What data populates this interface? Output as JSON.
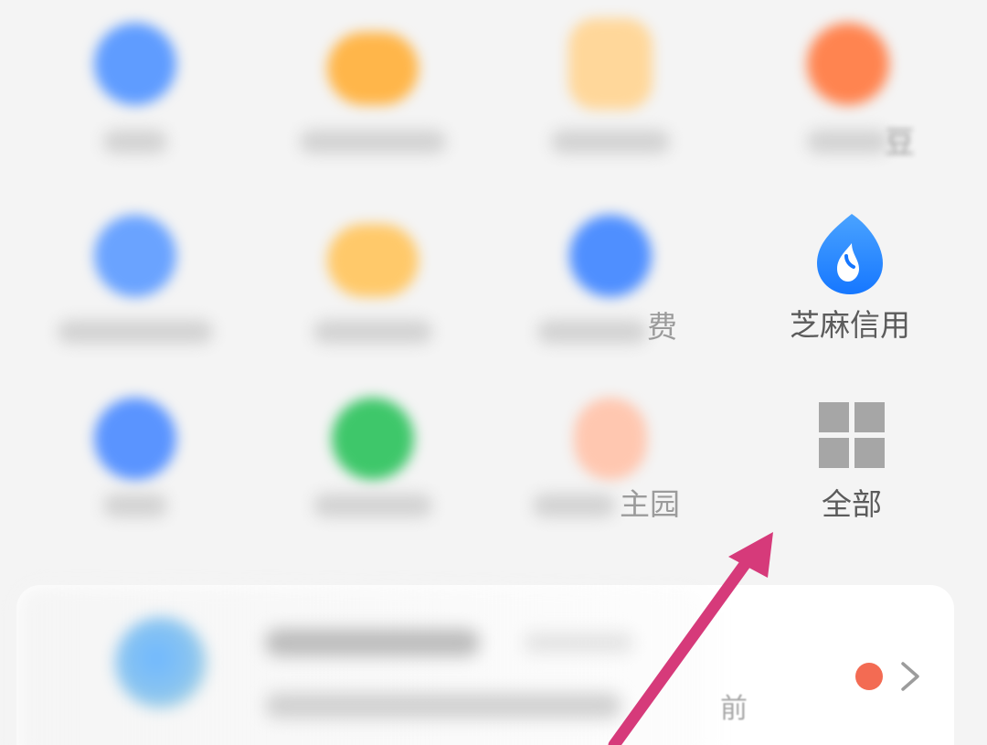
{
  "apps": {
    "zhima": {
      "label": "芝麻信用",
      "icon": "zhima-credit-drop-icon",
      "color": "#1e88ff"
    },
    "all": {
      "label": "全部",
      "icon": "grid-icon",
      "color": "#a6a6a6"
    },
    "partial_labels": {
      "row2_col3_tail": "费",
      "row3_col3_tail": "主园",
      "row1_col4_tail": "豆"
    }
  },
  "card": {
    "time_tail": "前",
    "badge_color": "#f36b53",
    "chevron": "chevron-right-icon"
  },
  "annotation": {
    "arrow_color": "#d63a7a"
  }
}
